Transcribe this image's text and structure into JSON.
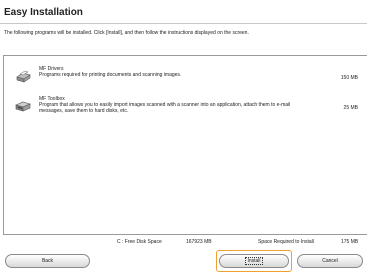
{
  "dialog": {
    "title": "Easy Installation",
    "instructions": "The following programs will be installed. Click [Install], and then follow the instructions displayed on the screen."
  },
  "programs": [
    {
      "name": "MF Drivers",
      "description": "Programs required for printing documents and scanning images.",
      "size": "150 MB",
      "icon": "printer-icon"
    },
    {
      "name": "MF Toolbox",
      "description": "Program that allows you to easily import images scanned with a scanner into an application, attach them to e-mail messages, save them to hard disks, etc.",
      "size": "25 MB",
      "icon": "scanner-icon"
    }
  ],
  "disk": {
    "free_label": "C : Free Disk Space",
    "free_value": "167923 MB",
    "required_label": "Space Required to Install",
    "required_value": "175 MB"
  },
  "buttons": {
    "back": "Back",
    "install": "Install",
    "cancel": "Cancel"
  }
}
